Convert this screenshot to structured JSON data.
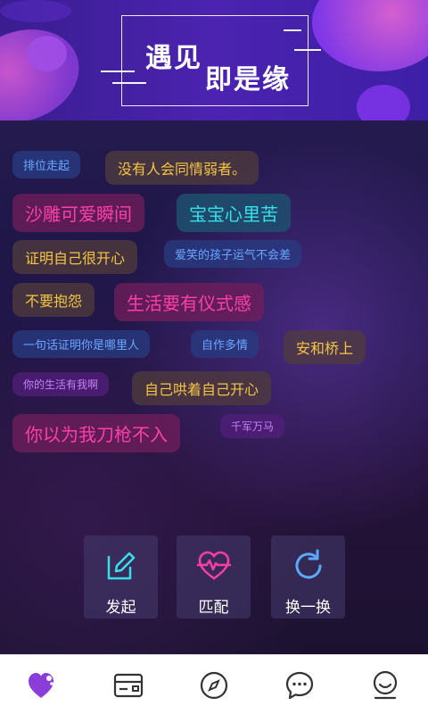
{
  "header": {
    "title_line1": "遇见",
    "title_line2": "即是缘"
  },
  "tags": [
    {
      "text": "排位走起",
      "color": "blue"
    },
    {
      "text": "没有人会同情弱者。",
      "color": "gold"
    },
    {
      "text": "沙雕可爱瞬间",
      "color": "pink"
    },
    {
      "text": "宝宝心里苦",
      "color": "cyan"
    },
    {
      "text": "证明自己很开心",
      "color": "gold"
    },
    {
      "text": "爱笑的孩子运气不会差",
      "color": "blue"
    },
    {
      "text": "不要抱怨",
      "color": "gold"
    },
    {
      "text": "生活要有仪式感",
      "color": "pink"
    },
    {
      "text": "一句话证明你是哪里人",
      "color": "blue"
    },
    {
      "text": "自作多情",
      "color": "blue"
    },
    {
      "text": "安和桥上",
      "color": "gold"
    },
    {
      "text": "你的生活有我啊",
      "color": "purple"
    },
    {
      "text": "自己哄着自己开心",
      "color": "gold"
    },
    {
      "text": "你以为我刀枪不入",
      "color": "pink"
    },
    {
      "text": "千军万马",
      "color": "purple"
    }
  ],
  "actions": [
    {
      "label": "发起",
      "icon": "edit-icon",
      "color": "#36e0e8"
    },
    {
      "label": "匹配",
      "icon": "heart-pulse-icon",
      "color": "#ff3fa8"
    },
    {
      "label": "换一换",
      "icon": "refresh-icon",
      "color": "#5aa9ff"
    }
  ],
  "tabbar": [
    {
      "icon": "heart-home-icon",
      "active": true,
      "color": "#8a3dd8"
    },
    {
      "icon": "card-icon",
      "active": false
    },
    {
      "icon": "compass-icon",
      "active": false
    },
    {
      "icon": "chat-icon",
      "active": false
    },
    {
      "icon": "profile-icon",
      "active": false
    }
  ],
  "colors": {
    "accent_purple": "#8a3dd8",
    "tag_blue": "#6aa7ff",
    "tag_gold": "#f4c542",
    "tag_pink": "#ff3fa8",
    "tag_cyan": "#36e0e8"
  }
}
